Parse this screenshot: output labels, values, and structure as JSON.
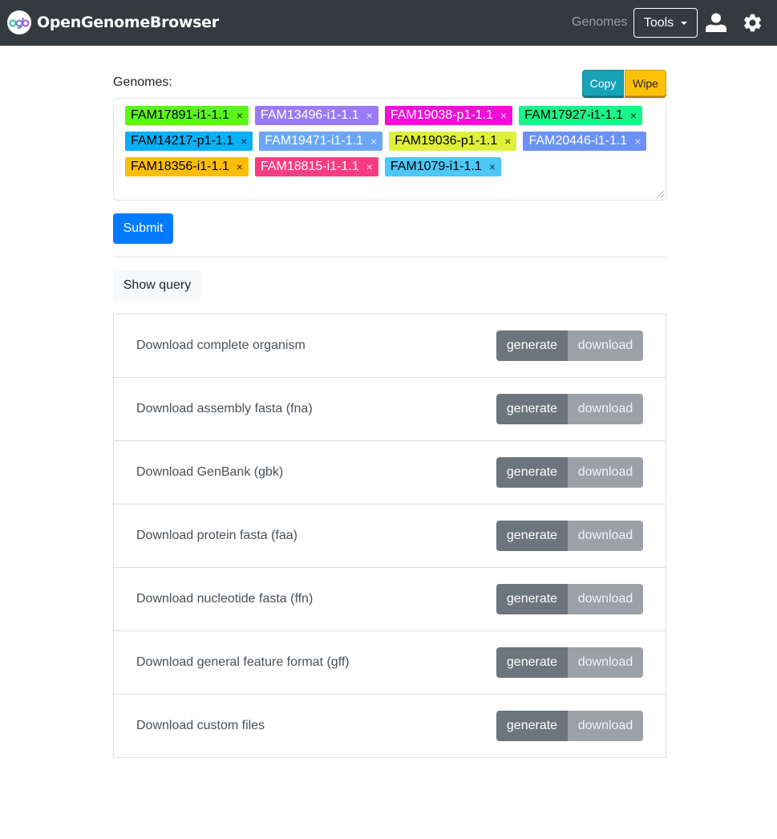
{
  "navbar": {
    "brand": "OpenGenomeBrowser",
    "logo_text": "ogb",
    "links": [
      {
        "label": "Genomes"
      }
    ],
    "tools_label": "Tools",
    "icons": [
      "user-icon",
      "gear-icon"
    ]
  },
  "genomes": {
    "label": "Genomes:",
    "copy_label": "Copy",
    "wipe_label": "Wipe",
    "tags": [
      {
        "label": "FAM17891-i1-1.1",
        "bg": "#5cf51a",
        "fg": "#000000"
      },
      {
        "label": "FAM13496-i1-1.1",
        "bg": "#9a7bf5",
        "fg": "#ffffff"
      },
      {
        "label": "FAM19038-p1-1.1",
        "bg": "#f00fd9",
        "fg": "#ffffff"
      },
      {
        "label": "FAM17927-i1-1.1",
        "bg": "#1af589",
        "fg": "#000000"
      },
      {
        "label": "FAM14217-p1-1.1",
        "bg": "#08b0f5",
        "fg": "#000000"
      },
      {
        "label": "FAM19471-i1-1.1",
        "bg": "#6ba6f5",
        "fg": "#ffffff"
      },
      {
        "label": "FAM19036-p1-1.1",
        "bg": "#def03a",
        "fg": "#000000"
      },
      {
        "label": "FAM20446-i1-1.1",
        "bg": "#6b91f5",
        "fg": "#ffffff"
      },
      {
        "label": "FAM18356-i1-1.1",
        "bg": "#fcbd0a",
        "fg": "#000000"
      },
      {
        "label": "FAM18815-i1-1.1",
        "bg": "#f73d82",
        "fg": "#ffffff"
      },
      {
        "label": "FAM1079-i1-1.1",
        "bg": "#4dc7f7",
        "fg": "#000000"
      }
    ],
    "remove_glyph": "×"
  },
  "actions": {
    "submit_label": "Submit",
    "show_query_label": "Show query"
  },
  "downloads": {
    "generate_label": "generate",
    "download_label": "download",
    "items": [
      {
        "label": "Download complete organism"
      },
      {
        "label": "Download assembly fasta (fna)"
      },
      {
        "label": "Download GenBank (gbk)"
      },
      {
        "label": "Download protein fasta (faa)"
      },
      {
        "label": "Download nucleotide fasta (ffn)"
      },
      {
        "label": "Download general feature format (gff)"
      },
      {
        "label": "Download custom files"
      }
    ]
  }
}
